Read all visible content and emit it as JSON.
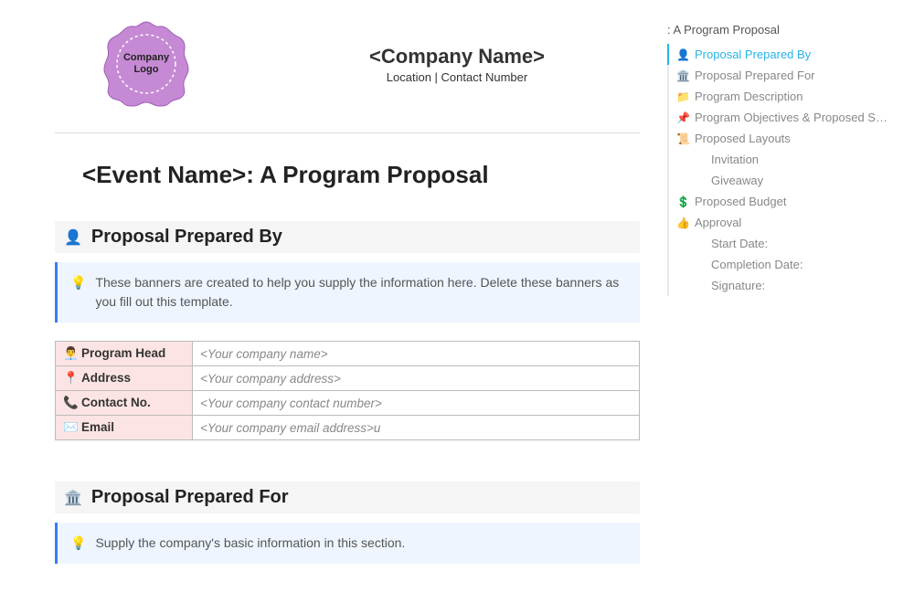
{
  "logo": {
    "line1": "Company",
    "line2": "Logo"
  },
  "header": {
    "company_name": "<Company Name>",
    "subline": "Location | Contact Number"
  },
  "event_title": "<Event Name>: A Program Proposal",
  "section1": {
    "icon": "👤",
    "title": "Proposal Prepared By",
    "banner": "These banners are created to help you supply the information here. Delete these banners as you fill out this template."
  },
  "table": {
    "rows": [
      {
        "icon": "👨‍💼",
        "label": "Program Head",
        "placeholder": "<Your company name>"
      },
      {
        "icon": "📍",
        "label": "Address",
        "placeholder": "<Your company address>"
      },
      {
        "icon": "📞",
        "label": "Contact No.",
        "placeholder": "<Your company contact number>"
      },
      {
        "icon": "✉️",
        "label": "Email",
        "placeholder": "<Your company email address>u"
      }
    ]
  },
  "section2": {
    "icon": "🏛️",
    "title": "Proposal Prepared For",
    "banner": "Supply the company's basic information in this section."
  },
  "outline": {
    "header": ": A Program Proposal",
    "items": [
      {
        "icon": "👤",
        "label": "Proposal Prepared By",
        "active": true
      },
      {
        "icon": "🏛️",
        "label": "Proposal Prepared For"
      },
      {
        "icon": "📁",
        "label": "Program Description"
      },
      {
        "icon": "📌",
        "label": "Program Objectives & Proposed S…"
      },
      {
        "icon": "📜",
        "label": "Proposed Layouts"
      },
      {
        "icon": "",
        "label": "Invitation",
        "sub": true
      },
      {
        "icon": "",
        "label": "Giveaway",
        "sub": true
      },
      {
        "icon": "💲",
        "label": "Proposed Budget"
      },
      {
        "icon": "👍",
        "label": "Approval"
      },
      {
        "icon": "",
        "label": "Start Date:",
        "sub": true
      },
      {
        "icon": "",
        "label": "Completion Date:",
        "sub": true
      },
      {
        "icon": "",
        "label": "Signature:",
        "sub": true
      }
    ]
  }
}
